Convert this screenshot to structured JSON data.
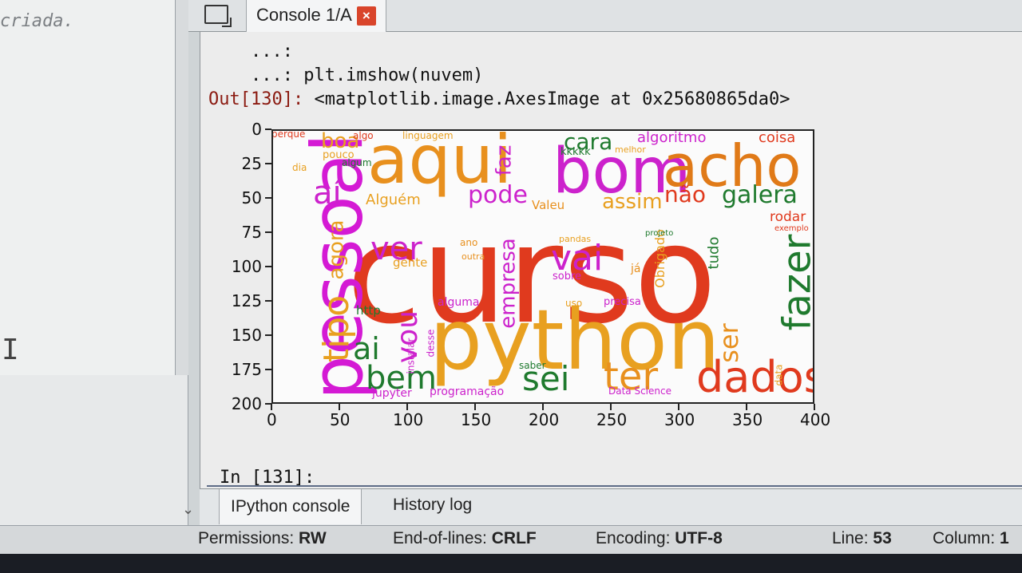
{
  "editor": {
    "code_fragment": "criada.",
    "cursor_glyph": "I"
  },
  "tabs": {
    "console_tab": "Console 1/A",
    "close_glyph": "×"
  },
  "console": {
    "line1": "    ...:",
    "line2": "    ...: plt.imshow(nuvem)",
    "out_prompt": "Out[130]:",
    "out_text": " <matplotlib.image.AxesImage at 0x25680865da0>",
    "in_prompt": "In [131]:"
  },
  "chart_data": {
    "type": "image",
    "xlim": [
      0,
      400
    ],
    "ylim": [
      200,
      0
    ],
    "xticks": [
      "0",
      "50",
      "100",
      "150",
      "200",
      "250",
      "300",
      "350",
      "400"
    ],
    "yticks": [
      "0",
      "25",
      "50",
      "75",
      "100",
      "125",
      "150",
      "175",
      "200"
    ],
    "words": [
      {
        "text": "curso",
        "color": "#e03a1e"
      },
      {
        "text": "python",
        "color": "#e8a020"
      },
      {
        "text": "pessoal",
        "color": "#d41ad4"
      },
      {
        "text": "aqui",
        "color": "#e8901e"
      },
      {
        "text": "bom",
        "color": "#cc22cc"
      },
      {
        "text": "acho",
        "color": "#e07a18"
      },
      {
        "text": "dados",
        "color": "#e03a1e"
      },
      {
        "text": "ter",
        "color": "#e8901e"
      },
      {
        "text": "fazer",
        "color": "#1f7a2e"
      },
      {
        "text": "sei",
        "color": "#1f7a2e"
      },
      {
        "text": "bem",
        "color": "#1f7a2e"
      },
      {
        "text": "vai",
        "color": "#cc22cc"
      },
      {
        "text": "ver",
        "color": "#cc22cc"
      },
      {
        "text": "tipo",
        "color": "#e8a020"
      },
      {
        "text": "aí",
        "color": "#cc22cc"
      },
      {
        "text": "ai",
        "color": "#1f7a2e"
      },
      {
        "text": "vou",
        "color": "#cc22cc"
      },
      {
        "text": "pode",
        "color": "#cc22cc"
      },
      {
        "text": "galera",
        "color": "#1f7a2e"
      },
      {
        "text": "não",
        "color": "#e03a1e"
      },
      {
        "text": "cara",
        "color": "#1f7a2e"
      },
      {
        "text": "assim",
        "color": "#e8a020"
      },
      {
        "text": "empresa",
        "color": "#cc22cc"
      },
      {
        "text": "agora",
        "color": "#e8a020"
      },
      {
        "text": "faz",
        "color": "#cc22cc"
      },
      {
        "text": "boa",
        "color": "#e8a020"
      },
      {
        "text": "ser",
        "color": "#e8901e"
      },
      {
        "text": "tudo",
        "color": "#1f7a2e"
      },
      {
        "text": "Obrigado",
        "color": "#e8a020"
      },
      {
        "text": "rodar",
        "color": "#e03a1e"
      },
      {
        "text": "algoritmo",
        "color": "#cc22cc"
      },
      {
        "text": "coisa",
        "color": "#e03a1e"
      },
      {
        "text": "Alguém",
        "color": "#e8a020"
      },
      {
        "text": "Valeu",
        "color": "#e8901e"
      },
      {
        "text": "gente",
        "color": "#e8a020"
      },
      {
        "text": "alguma",
        "color": "#cc22cc"
      },
      {
        "text": "http",
        "color": "#1f7a2e"
      },
      {
        "text": "sobre",
        "color": "#cc22cc"
      },
      {
        "text": "Data Science",
        "color": "#cc22cc"
      },
      {
        "text": "programação",
        "color": "#cc22cc"
      },
      {
        "text": "jupyter",
        "color": "#cc22cc"
      },
      {
        "text": "saber",
        "color": "#1f7a2e"
      },
      {
        "text": "outra",
        "color": "#e8901e"
      },
      {
        "text": "ano",
        "color": "#e8901e"
      },
      {
        "text": "pandas",
        "color": "#e8a020"
      },
      {
        "text": "projeto",
        "color": "#1f7a2e"
      },
      {
        "text": "melhor",
        "color": "#e8a020"
      },
      {
        "text": "kkkkk",
        "color": "#1f7a2e"
      },
      {
        "text": "perque",
        "color": "#e03a1e"
      },
      {
        "text": "pouco",
        "color": "#e8a020"
      },
      {
        "text": "algo",
        "color": "#e03a1e"
      },
      {
        "text": "linguagem",
        "color": "#e8a020"
      },
      {
        "text": "dia",
        "color": "#e8a020"
      },
      {
        "text": "algum",
        "color": "#1f7a2e"
      },
      {
        "text": "precisa",
        "color": "#cc22cc"
      },
      {
        "text": "uso",
        "color": "#e8a020"
      },
      {
        "text": "já",
        "color": "#e8901e"
      },
      {
        "text": "instalar",
        "color": "#cc22cc"
      },
      {
        "text": "desse",
        "color": "#cc22cc"
      },
      {
        "text": "data",
        "color": "#e8a020"
      },
      {
        "text": "exemplo",
        "color": "#e03a1e"
      }
    ]
  },
  "bottom_tabs": {
    "ipython": "IPython console",
    "history": "History log"
  },
  "status": {
    "permissions_label": "Permissions:",
    "permissions_value": "RW",
    "eol_label": "End-of-lines:",
    "eol_value": "CRLF",
    "encoding_label": "Encoding:",
    "encoding_value": "UTF-8",
    "line_label": "Line:",
    "line_value": "53",
    "column_label": "Column:",
    "column_value": "1"
  }
}
